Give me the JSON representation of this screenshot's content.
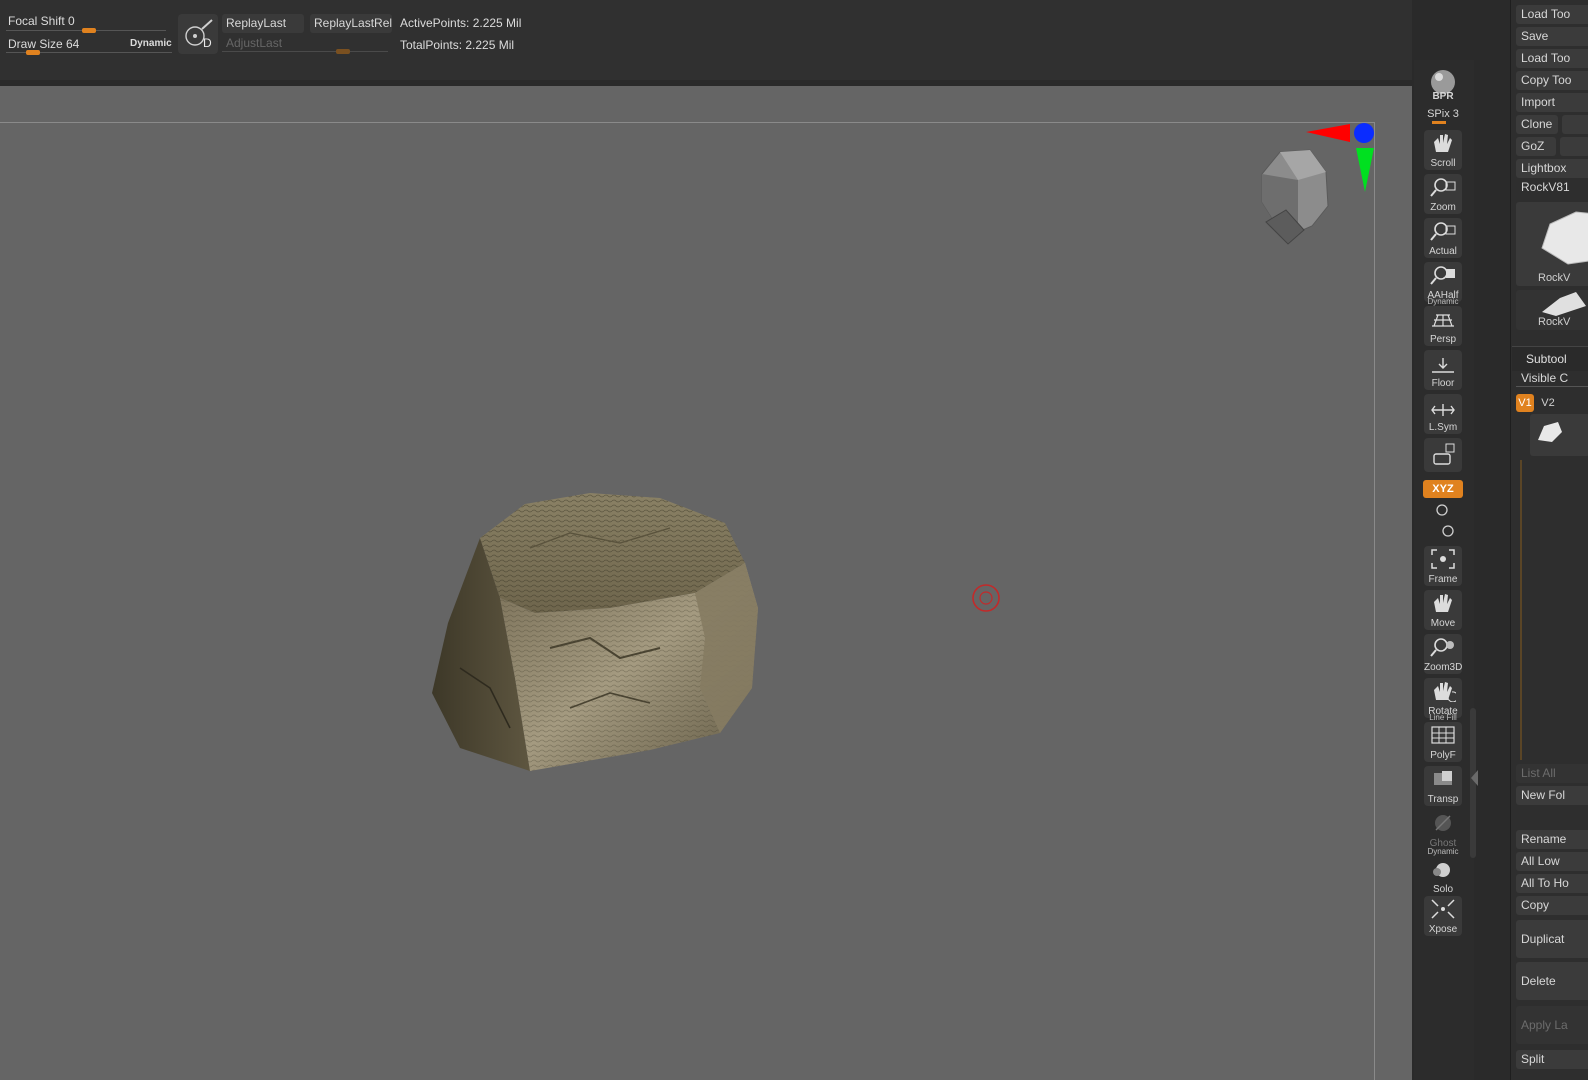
{
  "top": {
    "focal_shift_label": "Focal Shift",
    "focal_shift_value": "0",
    "draw_size_label": "Draw Size",
    "draw_size_value": "64",
    "dynamic_label": "Dynamic",
    "dynamic_d": "D",
    "replay_last": "ReplayLast",
    "replay_last_rel": "ReplayLastRel",
    "adjust_last": "AdjustLast",
    "active_points": "ActivePoints: 2.225 Mil",
    "total_points": "TotalPoints: 2.225 Mil",
    "focal_shift_level": 0.5,
    "draw_size_level": 0.2
  },
  "shelf": {
    "bpr": "BPR",
    "spix": "SPix 3",
    "scroll": "Scroll",
    "zoom": "Zoom",
    "actual": "Actual",
    "aahalf": "AAHalf",
    "persp_sub": "Dynamic",
    "persp": "Persp",
    "floor": "Floor",
    "lsym": "L.Sym",
    "xyz": "XYZ",
    "frame": "Frame",
    "move": "Move",
    "zoom3d": "Zoom3D",
    "rotate": "Rotate",
    "polyf_sub": "Line Fill",
    "polyf": "PolyF",
    "transp": "Transp",
    "ghost": "Ghost",
    "solo_sub": "Dynamic",
    "solo": "Solo",
    "xpose": "Xpose"
  },
  "panel": {
    "load_tool": "Load Too",
    "save": "Save",
    "load_tool2": "Load Too",
    "copy_tool": "Copy Too",
    "import": "Import",
    "clone": "Clone",
    "goz": "GoZ",
    "lightbox": "Lightbox",
    "tool_name": "RockV81",
    "thumb1_label": "RockV",
    "thumb2_label": "RockV",
    "subtool": "Subtool",
    "visible": "Visible C",
    "v1": "V1",
    "v2": "V2",
    "list_all": "List All",
    "new_folder": "New Fol",
    "rename": "Rename",
    "all_low": "All Low",
    "all_to_home": "All To Ho",
    "copy": "Copy",
    "duplicate": "Duplicat",
    "delete": "Delete",
    "apply_layers": "Apply La",
    "split": "Split"
  },
  "colors": {
    "accent": "#e0821f",
    "viewport_bg": "#656565",
    "axis_red": "#ff0000",
    "axis_green": "#00e020",
    "axis_blue": "#0a2cff"
  }
}
